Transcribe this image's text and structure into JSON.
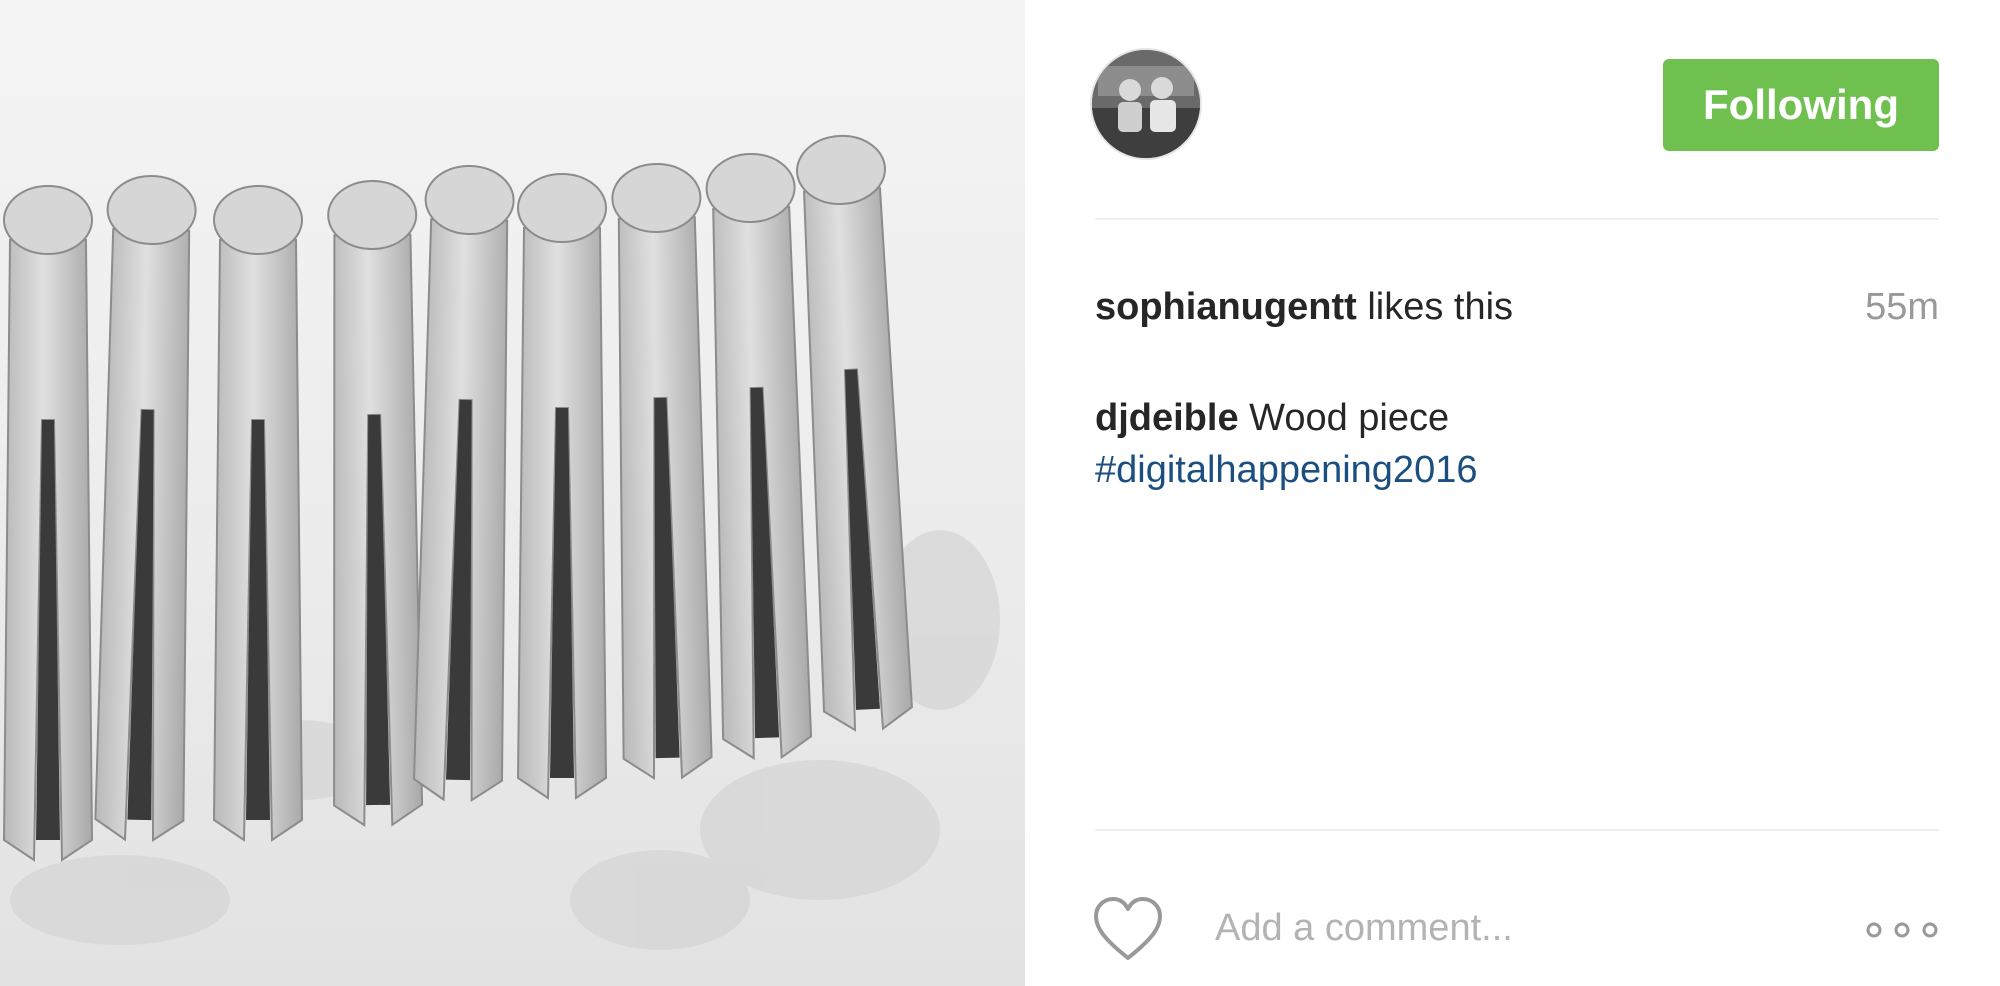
{
  "post": {
    "image_alt": "Black and white photo of wooden clothespins on a floral cloth"
  },
  "header": {
    "avatar_alt": "Profile photo",
    "follow_label": "Following",
    "follow_color": "#70c050"
  },
  "likes": {
    "username": "sophianugentt",
    "text": " likes this",
    "time": "55m"
  },
  "caption": {
    "author": "djdeible",
    "text": " Wood piece",
    "hashtag": "#digitalhappening2016",
    "hashtag_color": "#1c4f80"
  },
  "actions": {
    "like_icon": "heart-icon",
    "comment_placeholder": "Add a comment...",
    "more_icon": "more-options-icon"
  }
}
